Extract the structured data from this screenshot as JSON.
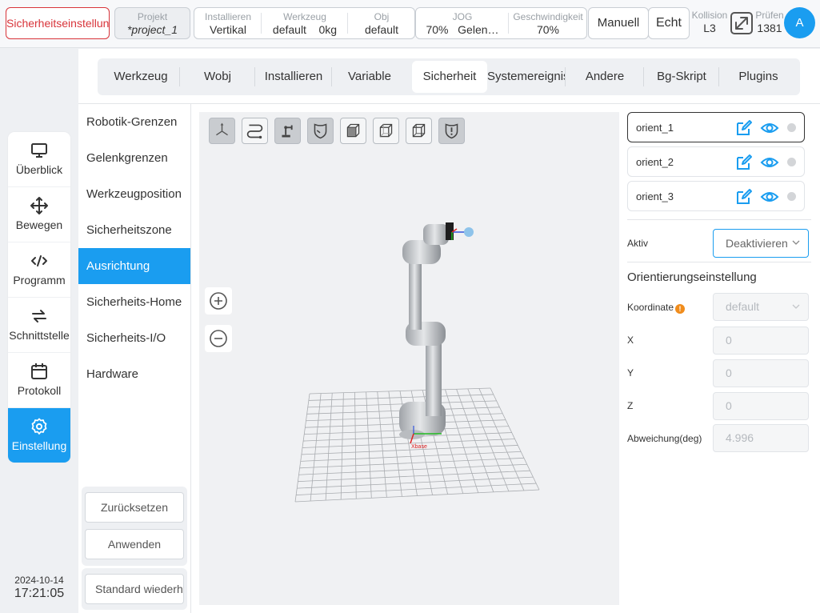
{
  "topbar": {
    "safety_label": "Sicherheitseinstellung",
    "project_label": "Projekt",
    "project_value": "*project_1",
    "install_label": "Installieren",
    "install_value": "Vertikal",
    "tool_label": "Werkzeug",
    "tool_value": "default",
    "tool_payload": "0kg",
    "obj_label": "Obj",
    "obj_value": "default",
    "jog_label": "JOG",
    "jog_value": "70%",
    "jog_mode": "Gelen…",
    "speed_label": "Geschwindigkeit",
    "speed_value": "70%",
    "manual_label": "Manuell",
    "real_label": "Echt",
    "collision_label": "Kollision",
    "collision_value": "L3",
    "check_label": "Prüfen",
    "check_value": "1381",
    "avatar_letter": "A"
  },
  "leftnav": {
    "items": [
      {
        "label": "Überblick",
        "icon": "monitor-icon"
      },
      {
        "label": "Bewegen",
        "icon": "move-arrows-icon"
      },
      {
        "label": "Programm",
        "icon": "code-icon"
      },
      {
        "label": "Schnittstelle",
        "icon": "exchange-arrows-icon"
      },
      {
        "label": "Protokoll",
        "icon": "calendar-icon"
      },
      {
        "label": "Einstellung",
        "icon": "gear-icon"
      }
    ],
    "active": "Einstellung"
  },
  "clock": {
    "date": "2024-10-14",
    "time": "17:21:05"
  },
  "tabs": {
    "items": [
      "Werkzeug",
      "Wobj",
      "Installieren",
      "Variable",
      "Sicherheit",
      "Systemereignis",
      "Andere",
      "Bg-Skript",
      "Plugins"
    ],
    "active": "Sicherheit"
  },
  "submenu": {
    "items": [
      "Robotik-Grenzen",
      "Gelenkgrenzen",
      "Werkzeugposition",
      "Sicherheitszone",
      "Ausrichtung",
      "Sicherheits-Home",
      "Sicherheits-I/O",
      "Hardware"
    ],
    "active": "Ausrichtung"
  },
  "actions": {
    "reset": "Zurücksetzen",
    "apply": "Anwenden",
    "restore": "Standard wiederherstellen"
  },
  "viewport": {
    "tools": [
      "axis-view-icon",
      "path-icon",
      "robot-icon",
      "shield-icon",
      "cube-front-icon",
      "cube-icon",
      "cube-wire-icon",
      "shield-alert-icon"
    ],
    "axis_label": "Xbase"
  },
  "orient": {
    "items": [
      "orient_1",
      "orient_2",
      "orient_3"
    ],
    "selected": "orient_1"
  },
  "settings": {
    "active_label": "Aktiv",
    "active_value": "Deaktivieren",
    "section_title": "Orientierungseinstellung",
    "coord_label": "Koordinate",
    "coord_value": "default",
    "x_label": "X",
    "x_value": "0",
    "y_label": "Y",
    "y_value": "0",
    "z_label": "Z",
    "z_value": "0",
    "dev_label": "Abweichung(deg)",
    "dev_value": "4.996"
  },
  "colors": {
    "accent": "#1a9df0",
    "danger": "#d8343a",
    "warning": "#f08c1c"
  }
}
